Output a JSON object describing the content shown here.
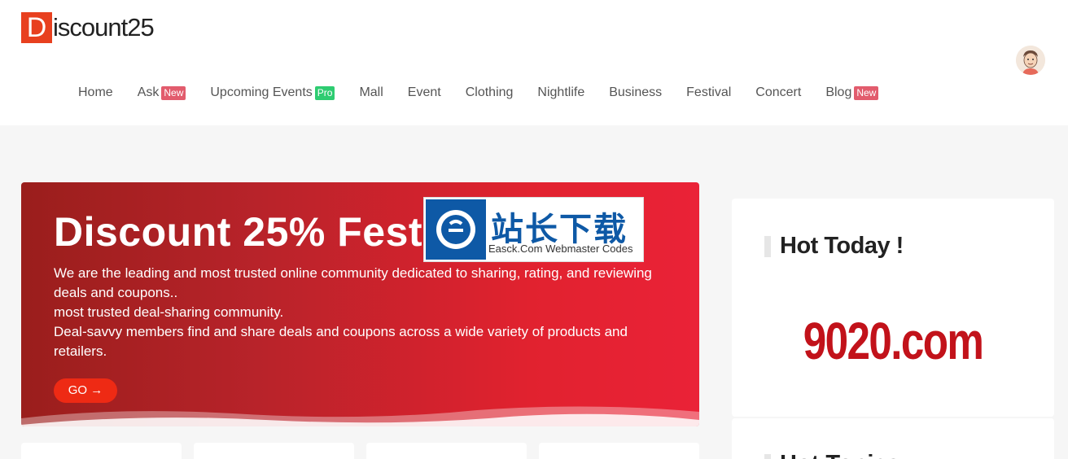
{
  "header": {
    "logo_mark": "D",
    "logo_text": "iscount25"
  },
  "nav": {
    "items": [
      {
        "label": "Home"
      },
      {
        "label": "Ask",
        "badge": "New"
      },
      {
        "label": "Upcoming Events",
        "badge": "Pro"
      },
      {
        "label": "Mall"
      },
      {
        "label": "Event"
      },
      {
        "label": "Clothing"
      },
      {
        "label": "Nightlife"
      },
      {
        "label": "Business"
      },
      {
        "label": "Festival"
      },
      {
        "label": "Concert"
      },
      {
        "label": "Blog",
        "badge": "New"
      }
    ]
  },
  "hero": {
    "title": "Discount 25% Festival",
    "lines": [
      "We are the leading and most trusted online community dedicated to sharing, rating, and reviewing deals and coupons..",
      "most trusted deal-sharing community.",
      "Deal-savvy members find and share deals and coupons across a wide variety of products and retailers."
    ],
    "button_label": "GO →"
  },
  "watermark": {
    "cn_text": "站长下载",
    "en_text": "Easck.Com Webmaster Codes"
  },
  "sidebar": {
    "hot_title": "Hot Today !",
    "hot_text": "9020.com",
    "next_title": "Hot Topics"
  },
  "colors": {
    "brand": "#e8401f",
    "hero_start": "#9a1e1c",
    "hero_end": "#ea2237",
    "badge_new": "#e25c6d",
    "badge_pro": "#2ecc71",
    "hot_text": "#c2121a"
  }
}
